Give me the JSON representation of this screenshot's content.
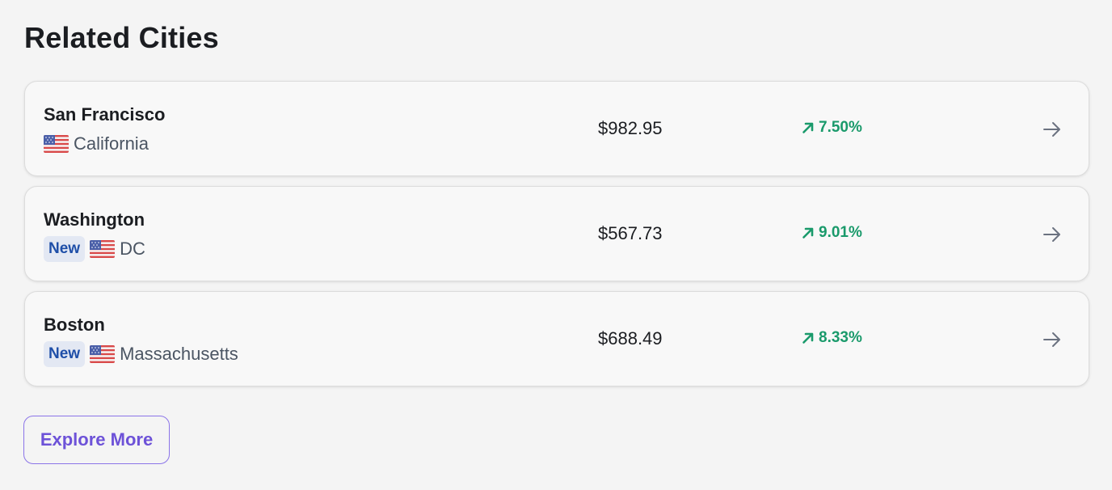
{
  "section": {
    "title": "Related Cities"
  },
  "cities": [
    {
      "name": "San Francisco",
      "is_new": false,
      "flag": "us-flag-icon",
      "region": "California",
      "price": "$982.95",
      "change": "7.50%",
      "trend": "up"
    },
    {
      "name": "Washington",
      "is_new": true,
      "badge_label": "New",
      "flag": "us-flag-icon",
      "region": "DC",
      "price": "$567.73",
      "change": "9.01%",
      "trend": "up"
    },
    {
      "name": "Boston",
      "is_new": true,
      "badge_label": "New",
      "flag": "us-flag-icon",
      "region": "Massachusetts",
      "price": "$688.49",
      "change": "8.33%",
      "trend": "up"
    }
  ],
  "actions": {
    "explore_more_label": "Explore More"
  },
  "colors": {
    "background": "#f4f4f4",
    "card_background": "#f8f8f8",
    "positive_change": "#1a9a6b",
    "new_badge_text": "#1f4fa8",
    "new_badge_background": "#e3e8f3",
    "explore_button_accent": "#6d52d8",
    "arrow_icon": "#6b7280"
  }
}
